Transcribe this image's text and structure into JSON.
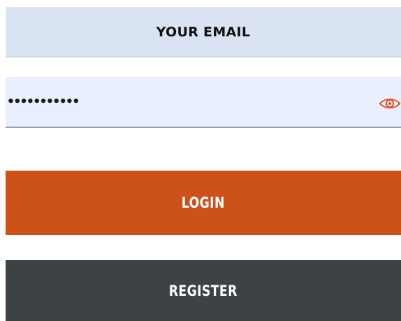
{
  "form": {
    "email_field": {
      "placeholder": "YOUR EMAIL",
      "background": "#d9e3f2"
    },
    "password_field": {
      "value": "•••••••••••",
      "background": "#e9efff",
      "toggle_icon": "eye-icon",
      "toggle_icon_color": "#e0522a"
    },
    "login_button": {
      "label": "LOGIN",
      "color": "#cc521a"
    },
    "register_button": {
      "label": "REGISTER",
      "color": "#3d4245"
    }
  }
}
